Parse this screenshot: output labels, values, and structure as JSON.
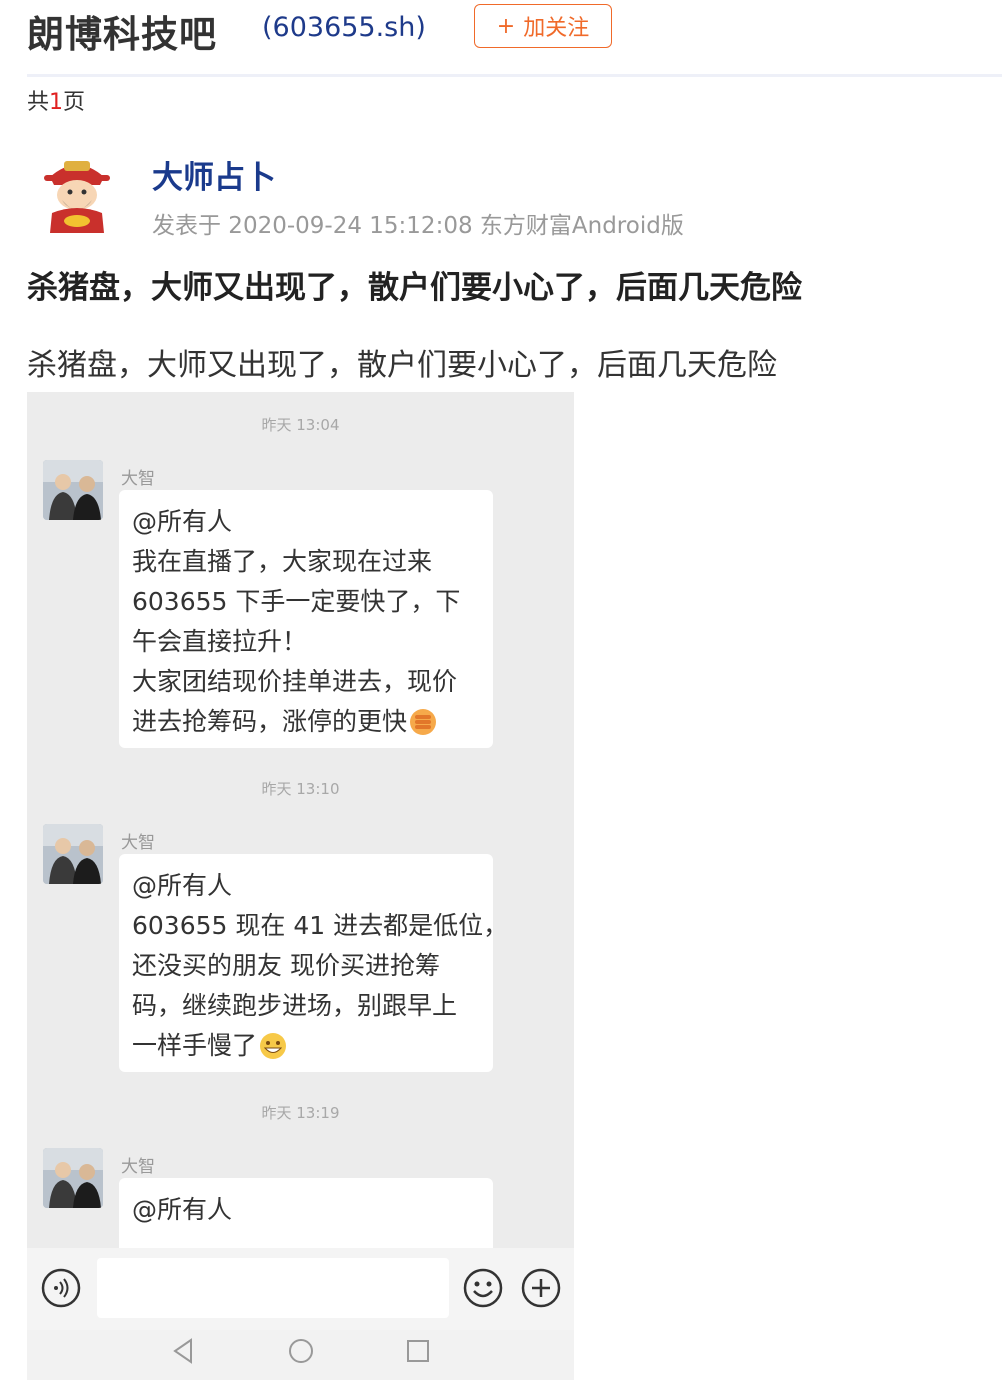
{
  "header": {
    "bar_name": "朗博科技吧",
    "stock_code": "(603655.sh)",
    "follow_plus": "+",
    "follow_label": "加关注"
  },
  "pagination": {
    "prefix": "共",
    "count": "1",
    "suffix": "页"
  },
  "post": {
    "author": "大师占卜",
    "meta": "发表于 2020-09-24 15:12:08 东方财富Android版",
    "title": "杀猪盘，大师又出现了，散户们要小心了，后面几天危险",
    "body": "杀猪盘，大师又出现了，散户们要小心了，后面几天危险"
  },
  "screenshot": {
    "messages": [
      {
        "time": "昨天 13:04",
        "sender": "大智",
        "lines": [
          "@所有人",
          "我在直播了，大家现在过来",
          "603655 下手一定要快了，下",
          "午会直接拉升！",
          "大家团结现价挂单进去，现价",
          "进去抢筹码，涨停的更快"
        ],
        "emoji": "fist-emoji"
      },
      {
        "time": "昨天 13:10",
        "sender": "大智",
        "lines": [
          "@所有人",
          "603655 现在 41 进去都是低位，",
          "还没买的朋友 现价买进抢筹",
          "码，继续跑步进场，别跟早上",
          "一样手慢了"
        ],
        "emoji": "grin-emoji"
      },
      {
        "time": "昨天 13:19",
        "sender": "大智",
        "lines": [
          "@所有人"
        ],
        "emoji": ""
      }
    ],
    "colors": {
      "background": "#ececec",
      "bubble": "#ffffff"
    }
  },
  "colors": {
    "accent_orange": "#f06a2a",
    "link_blue": "#1a3a8c",
    "page_count_red": "#e02020"
  },
  "icons": {
    "voice": "voice-icon",
    "emoji": "smiley-icon",
    "plus": "plus-circle-icon",
    "back": "nav-back-icon",
    "home": "nav-home-icon",
    "recent": "nav-recent-icon"
  }
}
